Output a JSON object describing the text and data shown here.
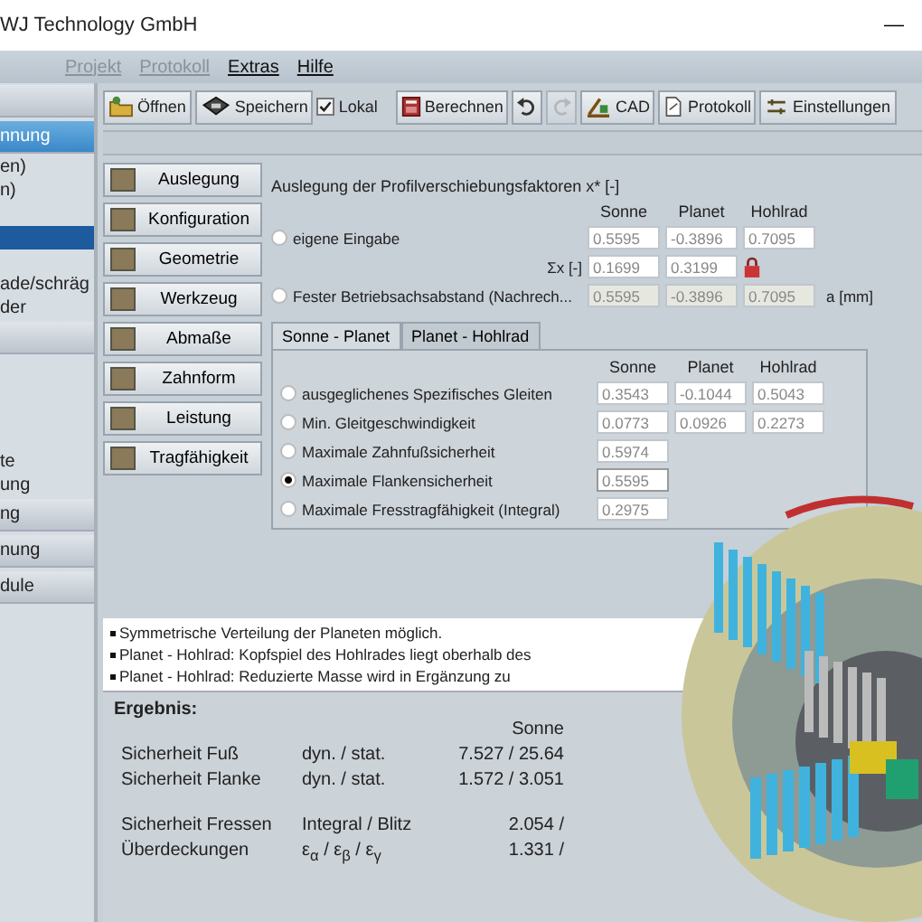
{
  "window": {
    "title": "WJ Technology GmbH",
    "minimize": "—"
  },
  "menu": [
    {
      "label": "Projekt",
      "disabled": true
    },
    {
      "label": "Protokoll",
      "disabled": true
    },
    {
      "label": "Extras",
      "disabled": false
    },
    {
      "label": "Hilfe",
      "disabled": false
    }
  ],
  "sidebar": {
    "items": [
      {
        "kind": "header",
        "selected": false
      },
      {
        "kind": "header",
        "label": "nnung",
        "selected": true
      },
      {
        "kind": "item",
        "label": "en)",
        "selected": false
      },
      {
        "kind": "item",
        "label": "n)",
        "selected": false
      },
      {
        "kind": "item",
        "selected": false
      },
      {
        "kind": "item",
        "selected": true
      },
      {
        "kind": "item",
        "selected": false
      },
      {
        "kind": "item",
        "label": "ade/schräg",
        "selected": false
      },
      {
        "kind": "item",
        "label": "der",
        "selected": false
      },
      {
        "kind": "header",
        "selected": false
      },
      {
        "kind": "item",
        "selected": false
      },
      {
        "kind": "item",
        "selected": false
      },
      {
        "kind": "item",
        "selected": false
      },
      {
        "kind": "item",
        "selected": false
      },
      {
        "kind": "item",
        "label": "te",
        "selected": false
      },
      {
        "kind": "item",
        "label": "ung",
        "selected": false
      },
      {
        "kind": "header",
        "label": "ng",
        "selected": false
      },
      {
        "kind": "header",
        "label": "nung",
        "selected": false
      },
      {
        "kind": "header",
        "label": "dule",
        "selected": false
      }
    ]
  },
  "toolbar": [
    {
      "kind": "open",
      "label": "Öffnen",
      "disabled": false
    },
    {
      "kind": "save",
      "label": "Speichern",
      "disabled": false
    },
    {
      "kind": "checkbox",
      "label": "Lokal",
      "checked": true
    },
    {
      "kind": "calculate",
      "label": "Berechnen",
      "disabled": false
    },
    {
      "kind": "undo",
      "disabled": false
    },
    {
      "kind": "redo",
      "disabled": true
    },
    {
      "kind": "cad",
      "label": "CAD",
      "disabled": false
    },
    {
      "kind": "report",
      "label": "Protokoll",
      "disabled": false
    },
    {
      "kind": "settings",
      "label": "Einstellungen",
      "disabled": false
    }
  ],
  "nav_buttons": [
    "Auslegung",
    "Konfiguration",
    "Geometrie",
    "Werkzeug",
    "Abmaße",
    "Zahnform",
    "Leistung",
    "Tragfähigkeit"
  ],
  "design": {
    "title": "Auslegung der Profilverschiebungsfaktoren x* [-]",
    "columns": [
      "Sonne",
      "Planet",
      "Hohlrad"
    ],
    "own_input": {
      "label": "eigene Eingabe",
      "selected": false,
      "values": [
        "0.5595",
        "-0.3896",
        "0.7095"
      ]
    },
    "sum": {
      "label": "Σx [-]",
      "values": [
        "0.1699",
        "0.3199"
      ]
    },
    "fixed": {
      "label": "Fester Betriebsachsabstand (Nachrech...",
      "selected": false,
      "values": [
        "0.5595",
        "-0.3896",
        "0.7095"
      ],
      "unit": "a [mm]"
    }
  },
  "tabs": [
    {
      "label": "Sonne - Planet",
      "selected": true
    },
    {
      "label": "Planet - Hohlrad",
      "selected": false
    }
  ],
  "tab_table": {
    "columns": [
      "Sonne",
      "Planet",
      "Hohlrad"
    ],
    "rows": [
      {
        "label": "ausgeglichenes Spezifisches Gleiten",
        "selected": false,
        "values": [
          "0.3543",
          "-0.1044",
          "0.5043"
        ]
      },
      {
        "label": "Min. Gleitgeschwindigkeit",
        "selected": false,
        "values": [
          "0.0773",
          "0.0926",
          "0.2273"
        ]
      },
      {
        "label": "Maximale Zahnfußsicherheit",
        "selected": false,
        "values": [
          "0.5974"
        ]
      },
      {
        "label": "Maximale Flankensicherheit",
        "selected": true,
        "values": [
          "0.5595"
        ]
      },
      {
        "label": "Maximale Fresstragfähigkeit (Integral)",
        "selected": false,
        "values": [
          "0.2975"
        ]
      }
    ]
  },
  "notes": [
    "Symmetrische Verteilung der Planeten möglich.",
    "Planet - Hohlrad: Kopfspiel des Hohlrades liegt oberhalb des",
    "Planet - Hohlrad: Reduzierte Masse wird in Ergänzung zu"
  ],
  "results": {
    "title": "Ergebnis:",
    "column": "Sonne",
    "rows": [
      {
        "label": "Sicherheit Fuß",
        "type": "dyn. / stat.",
        "value": "7.527 / 25.64"
      },
      {
        "label": "Sicherheit Flanke",
        "type": "dyn. / stat.",
        "value": "1.572 / 3.051"
      },
      {
        "label": "Sicherheit Fressen",
        "type": "Integral / Blitz",
        "value": "2.054 /"
      },
      {
        "label": "Überdeckungen",
        "type": "ε$_{α}$ / ε$_{β}$ / ε$_{γ}$",
        "value": "1.331 /"
      }
    ]
  }
}
